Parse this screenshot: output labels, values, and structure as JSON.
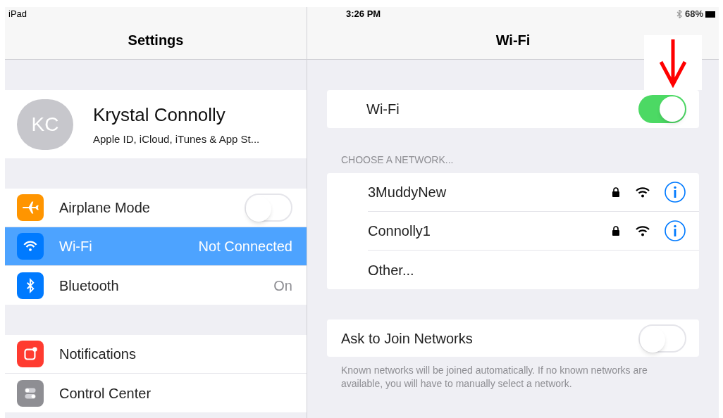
{
  "status_bar": {
    "device": "iPad",
    "time": "3:26 PM",
    "battery": "68%"
  },
  "sidebar": {
    "title": "Settings",
    "profile": {
      "initials": "KC",
      "name": "Krystal Connolly",
      "subtitle": "Apple ID, iCloud, iTunes & App St..."
    },
    "groups": [
      [
        {
          "kind": "toggle",
          "label": "Airplane Mode",
          "on": false,
          "selected": false
        },
        {
          "kind": "value",
          "label": "Wi-Fi",
          "value": "Not Connected",
          "selected": true
        },
        {
          "kind": "value",
          "label": "Bluetooth",
          "value": "On",
          "selected": false
        }
      ],
      [
        {
          "kind": "plain",
          "label": "Notifications",
          "selected": false
        },
        {
          "kind": "plain",
          "label": "Control Center",
          "selected": false
        }
      ]
    ]
  },
  "detail": {
    "title": "Wi-Fi",
    "wifi": {
      "label": "Wi-Fi",
      "on": true
    },
    "section_header": "CHOOSE A NETWORK...",
    "networks": [
      {
        "kind": "network",
        "name": "3MuddyNew",
        "locked": true
      },
      {
        "kind": "network",
        "name": "Connolly1",
        "locked": true
      },
      {
        "kind": "other",
        "name": "Other..."
      }
    ],
    "ask_to_join": {
      "label": "Ask to Join Networks",
      "on": false
    },
    "footer": "Known networks will be joined automatically. If no known networks are available, you will have to manually select a network."
  }
}
